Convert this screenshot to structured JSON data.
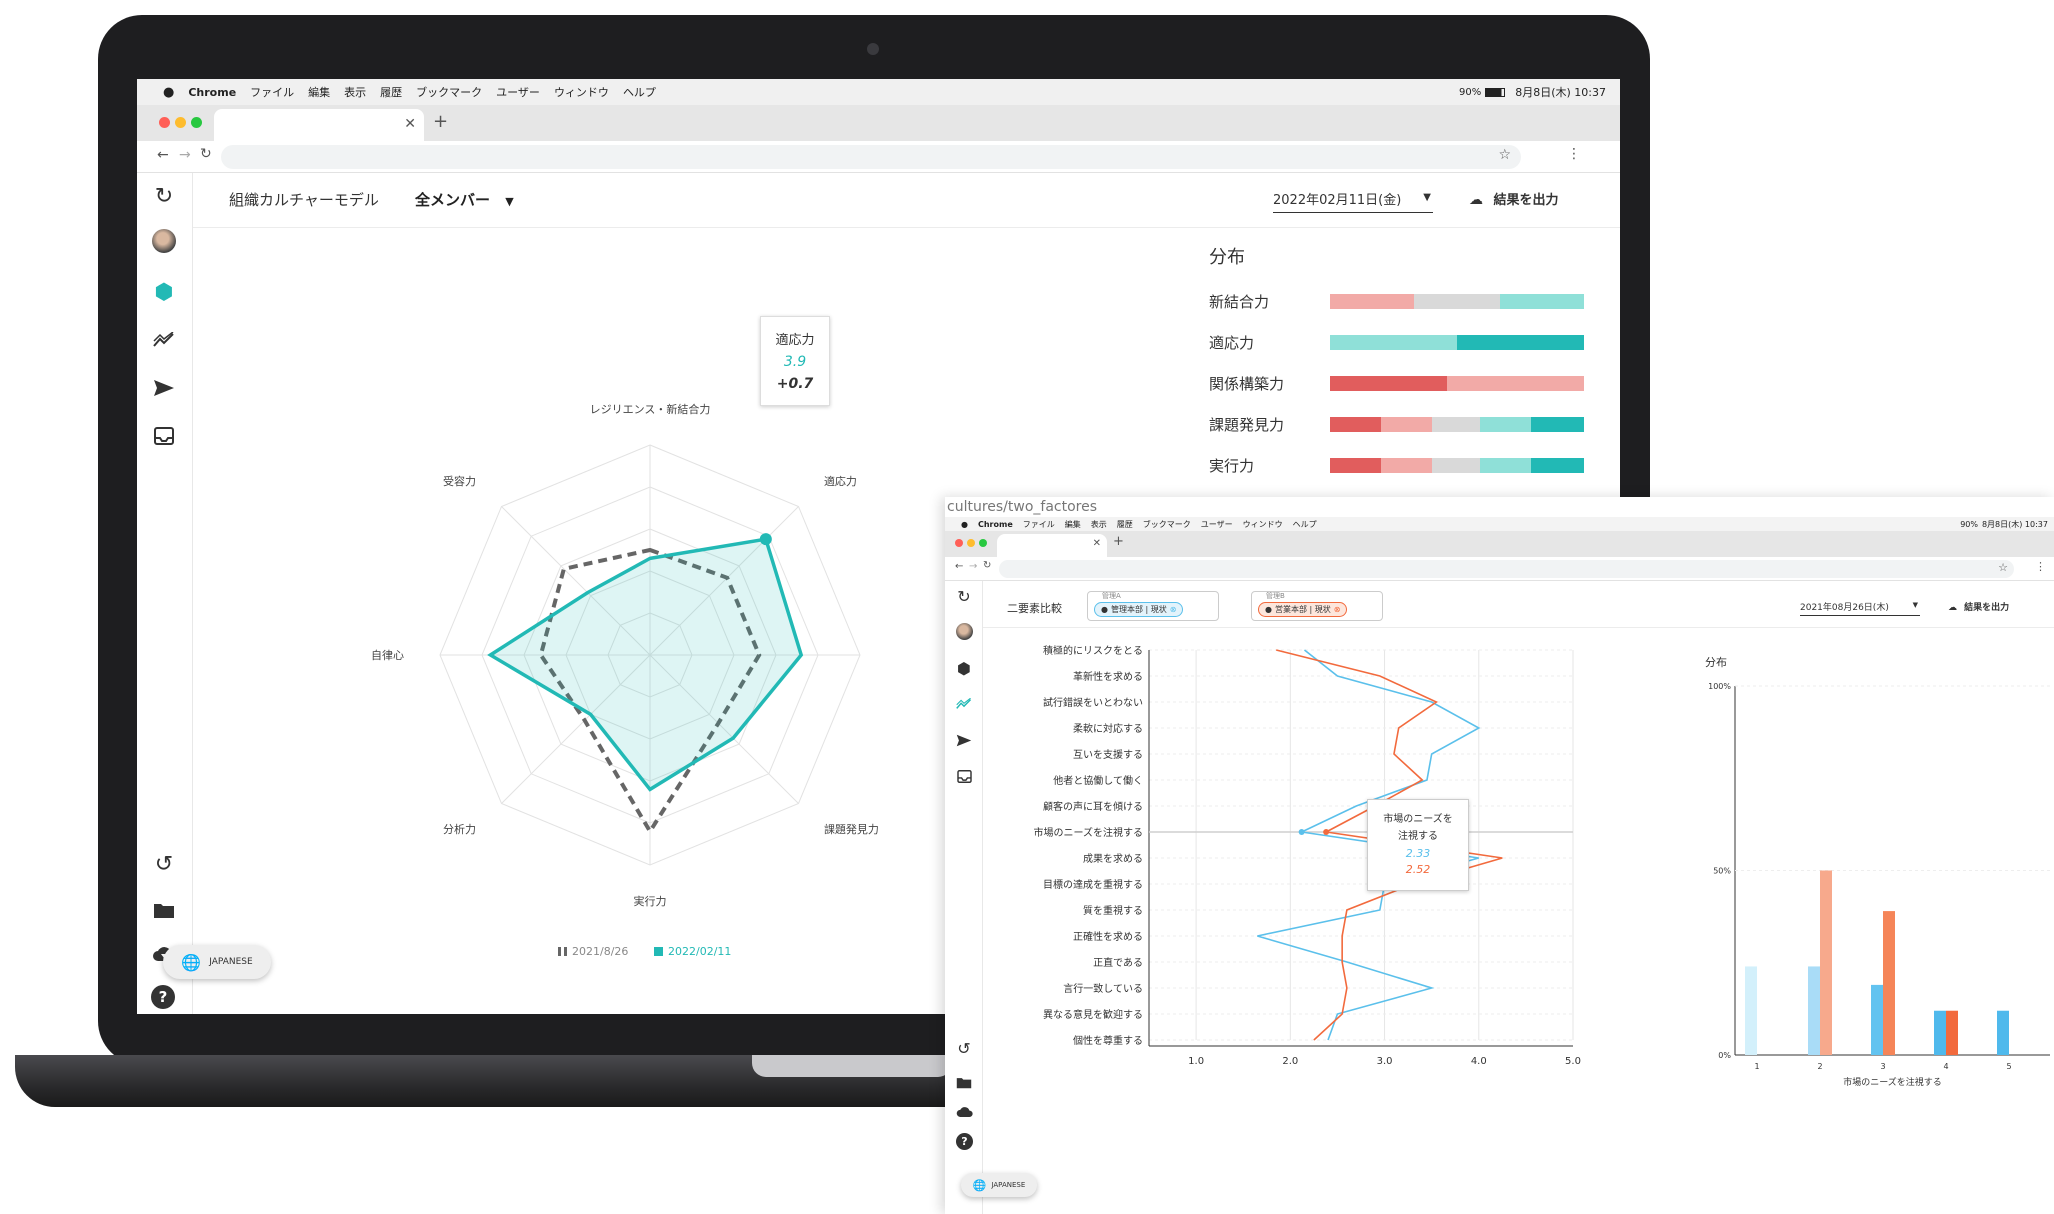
{
  "menubar": {
    "app": "Chrome",
    "items": [
      "ファイル",
      "編集",
      "表示",
      "履歴",
      "ブックマーク",
      "ユーザー",
      "ウィンドウ",
      "ヘルプ"
    ],
    "battery": "90%",
    "datetime": "8月8日(木) 10:37"
  },
  "main_window": {
    "page_title": "組織カルチャーモデル",
    "member_select": "全メンバー",
    "date_select": "2022年02月11日(金)",
    "export_label": "結果を出力",
    "lang_label": "JAPANESE",
    "distribution": {
      "title": "分布",
      "rows": [
        {
          "label": "新結合力",
          "segments": [
            {
              "w": 0.33,
              "c": "#f2aaa7"
            },
            {
              "w": 0.34,
              "c": "#d9d9d9"
            },
            {
              "w": 0.33,
              "c": "#8fe0d8"
            }
          ]
        },
        {
          "label": "適応力",
          "segments": [
            {
              "w": 0.5,
              "c": "#8fe0d8"
            },
            {
              "w": 0.5,
              "c": "#22b9b5"
            }
          ]
        },
        {
          "label": "関係構築力",
          "segments": [
            {
              "w": 0.46,
              "c": "#e15d5d"
            },
            {
              "w": 0.54,
              "c": "#f2aaa7"
            }
          ]
        },
        {
          "label": "課題発見力",
          "segments": [
            {
              "w": 0.2,
              "c": "#e15d5d"
            },
            {
              "w": 0.2,
              "c": "#f2aaa7"
            },
            {
              "w": 0.19,
              "c": "#d9d9d9"
            },
            {
              "w": 0.2,
              "c": "#8fe0d8"
            },
            {
              "w": 0.21,
              "c": "#22b9b5"
            }
          ]
        },
        {
          "label": "実行力",
          "segments": [
            {
              "w": 0.2,
              "c": "#e15d5d"
            },
            {
              "w": 0.2,
              "c": "#f2aaa7"
            },
            {
              "w": 0.19,
              "c": "#d9d9d9"
            },
            {
              "w": 0.2,
              "c": "#8fe0d8"
            },
            {
              "w": 0.21,
              "c": "#22b9b5"
            }
          ]
        }
      ]
    },
    "tooltip": {
      "label": "適応力",
      "value": "3.9",
      "delta": "+0.7"
    }
  },
  "chart_data": [
    {
      "type": "radar",
      "axes": [
        "レジリエンス・新結合力",
        "適応力",
        "自律心",
        "課題発見力",
        "実行力",
        "分析力",
        "受容力"
      ],
      "axes_display_order": [
        "レジリエンス・新結合力",
        "適応力",
        "",
        "課題発見力",
        "実行力",
        "分析力",
        "自律心",
        "受容力"
      ],
      "rmax": 5,
      "series": [
        {
          "name": "2021/8/26",
          "style": "dashed",
          "color": "#666666",
          "values": [
            2.5,
            2.6,
            2.6,
            2.3,
            4.2,
            2.2,
            2.6,
            2.9
          ]
        },
        {
          "name": "2022/02/11",
          "style": "solid",
          "color": "#22b9b5",
          "values": [
            2.3,
            3.9,
            3.6,
            2.8,
            3.2,
            2.0,
            3.8,
            2.1
          ]
        }
      ]
    },
    {
      "type": "line",
      "title": "",
      "orientation": "horizontal",
      "categories": [
        "積極的にリスクをとる",
        "革新性を求める",
        "試行錯誤をいとわない",
        "柔軟に対応する",
        "互いを支援する",
        "他者と協働して働く",
        "顧客の声に耳を傾ける",
        "市場のニーズを注視する",
        "成果を求める",
        "目標の達成を重視する",
        "質を重視する",
        "正確性を求める",
        "正直である",
        "言行一致している",
        "異なる意見を歓迎する",
        "個性を尊重する"
      ],
      "xlim": [
        0.5,
        5.0
      ],
      "xticks": [
        "1.0",
        "2.0",
        "3.0",
        "4.0",
        "5.0"
      ],
      "series": [
        {
          "name": "管理本部 | 現状",
          "color": "#5bc0eb",
          "values": [
            2.15,
            2.5,
            3.5,
            4.0,
            3.5,
            3.45,
            2.7,
            2.12,
            4.0,
            3.0,
            2.95,
            1.65,
            2.6,
            3.5,
            2.5,
            2.4
          ]
        },
        {
          "name": "営業本部 | 現状",
          "color": "#f26a3d",
          "values": [
            1.85,
            2.95,
            3.55,
            3.15,
            3.1,
            3.4,
            2.9,
            2.38,
            4.25,
            3.3,
            2.6,
            2.55,
            2.55,
            2.6,
            2.55,
            2.25
          ]
        }
      ]
    },
    {
      "type": "bar",
      "title": "分布",
      "xlabel": "市場のニーズを注視する",
      "categories": [
        "1",
        "2",
        "3",
        "4",
        "5"
      ],
      "yticks": [
        "0%",
        "50%",
        "100%"
      ],
      "ylim": [
        0,
        100
      ],
      "series_colors": [
        "#d3f0fb",
        "#a9dcf7",
        "#62c3f0",
        "#f7a98c",
        "#f26a3d"
      ],
      "values": [
        [
          24,
          null
        ],
        [
          24,
          50
        ],
        [
          19,
          39
        ],
        [
          12,
          12
        ],
        [
          12,
          null
        ]
      ]
    }
  ],
  "second_window": {
    "path": "cultures/two_factores",
    "page_title": "二要素比較",
    "chip1_label": "管理A",
    "chip1_value": "管理本部 | 現状",
    "chip2_label": "管理B",
    "chip2_value": "営業本部 | 現状",
    "date_select": "2021年08月26日(木)",
    "export_label": "結果を出力",
    "lang_label": "JAPANESE",
    "tooltip": {
      "label1": "市場のニーズを",
      "label2": "注視する",
      "v1": "2.33",
      "v2": "2.52"
    },
    "legend_2021": "2021/8/26",
    "legend_2022": "2022/02/11"
  }
}
